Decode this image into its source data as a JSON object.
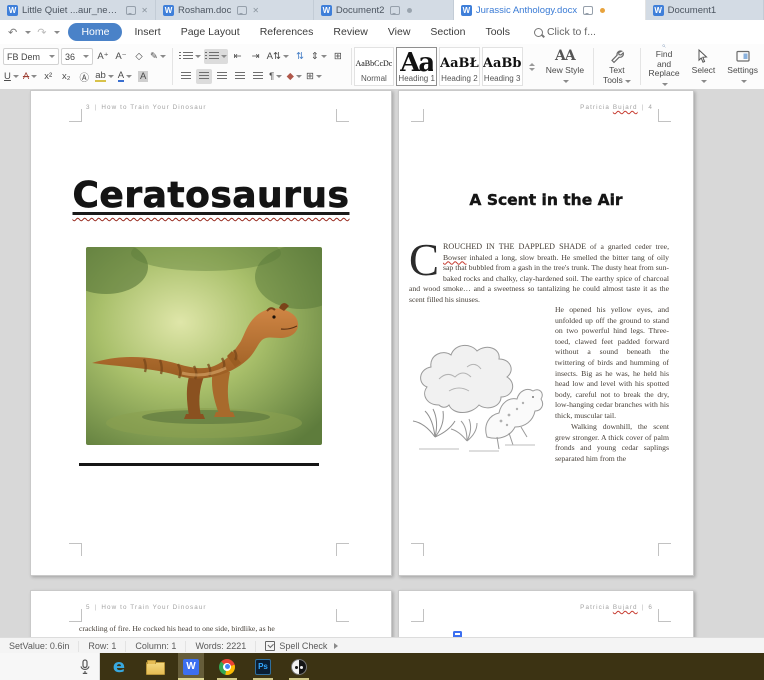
{
  "tab_bar": {
    "close_glyph": "✕",
    "tabs": [
      {
        "label": "Little Quiet ...aur_new words"
      },
      {
        "label": "Rosham.doc"
      },
      {
        "label": "Document2"
      },
      {
        "label": "Jurassic Anthology.docx"
      },
      {
        "label": "Document1"
      }
    ]
  },
  "menu_bar": {
    "undo_glyph": "↶",
    "redo_glyph": "↷",
    "items": [
      "Home",
      "Insert",
      "Page Layout",
      "References",
      "Review",
      "View",
      "Section",
      "Tools"
    ],
    "active_item": "Home",
    "search_hint": "Click to f..."
  },
  "ribbon": {
    "font_name": "FB Dem",
    "font_size": "36",
    "font_r1_glyphs": [
      "A⁺",
      "A⁻",
      "◇",
      "✎"
    ],
    "font_r2_glyphs": [
      "U",
      "A",
      "x²",
      "x₂",
      "Ⓐ",
      "ab",
      "A",
      "A"
    ],
    "para_r1_glyphs": [
      "⇤",
      "⇥",
      "A⇅",
      "⇅",
      "⇕",
      "⊞"
    ],
    "para_r2_glyphs": [
      "¶",
      "◆",
      "⊞"
    ],
    "styles": {
      "cards": [
        {
          "sample": "AaBbCcDc",
          "label": "Normal"
        },
        {
          "sample": "Aa",
          "label": "Heading 1",
          "selected": true
        },
        {
          "sample": "AaBŁ",
          "label": "Heading 2"
        },
        {
          "sample": "AaBb",
          "label": "Heading 3"
        }
      ],
      "new_style_icon": "AA",
      "new_style_label": "New Style"
    },
    "tools": {
      "text_tools": "Text Tools",
      "find_line1": "Find and",
      "find_line2": "Replace",
      "select": "Select",
      "settings": "Settings"
    }
  },
  "document": {
    "page3": {
      "number": "3",
      "sep": "|",
      "running_head": "How to Train Your Dinosaur",
      "title": "Ceratosaurus"
    },
    "page4": {
      "author": "Patricia",
      "author_last": "Bujard",
      "sep": "|",
      "number": "4",
      "title": "A Scent in the Air",
      "dropcap": "C",
      "p1_smallcaps": "ROUCHED IN THE DAPPLED SHADE",
      "p1_a": " of a gnarled ceder tree, ",
      "p1_misspelled": "Bowser",
      "p1_b": " inhaled a long, slow breath. He smelled the bitter tang of oily sap that bubbled from a gash in the tree's trunk. The dusty heat from sun-baked rocks and chalky, clay-hardened soil. The earthy spice of charcoal and wood smoke… and a sweetness so tantalizing he could almost taste it as the scent filled his sinuses.",
      "p2": "He opened his yellow eyes, and unfolded up off the ground to stand on two powerful hind legs. Three-toed, clawed feet padded forward without a sound beneath the twittering of birds and humming of insects. Big as he was, he held his head low and level with his spotted body, careful not to break the dry, low-hanging cedar branches with his thick, muscular tail.",
      "p3": "Walking downhill, the scent grew stronger. A thick cover of palm fronds and young cedar saplings separated him from the"
    },
    "page5": {
      "number": "5",
      "sep": "|",
      "running_head": "How to Train Your Dinosaur",
      "line": "crackling of fire. He cocked his head to one side, birdlike, as he"
    },
    "page6": {
      "author": "Patricia",
      "author_last": "Bujard",
      "sep": "|",
      "number": "6"
    }
  },
  "status_bar": {
    "set_value": "SetValue: 0.6in",
    "row": "Row: 1",
    "column": "Column: 1",
    "words": "Words: 2221",
    "spell_check": "Spell Check"
  },
  "taskbar": {
    "edge_glyph": "e",
    "wps_glyph": "W",
    "ps_glyph": "Ps",
    "icon_names": [
      "microphone",
      "edge-browser",
      "file-explorer",
      "wps-writer",
      "chrome",
      "photoshop",
      "yinyang-app"
    ]
  },
  "colors": {
    "accent_blue": "#4a82c8",
    "active_tab_text": "#3a7bd5",
    "modified_dot_orange": "#e8a33d",
    "squiggle_red": "#c63a2f",
    "taskbar_olive": "#3c3313",
    "wps_blue": "#3c6ff0",
    "ps_blue": "#31a8ff"
  }
}
